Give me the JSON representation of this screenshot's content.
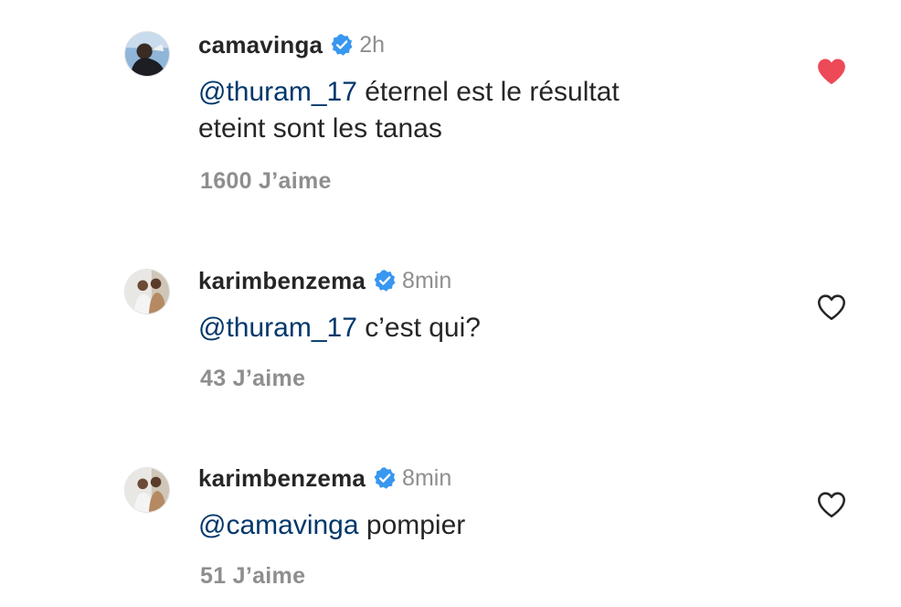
{
  "comments": [
    {
      "username": "camavinga",
      "verified_icon": "verified-badge-icon",
      "time": "2h",
      "mention": "@thuram_17",
      "text_line1": " éternel est le résultat",
      "text_line2": "eteint sont les tanas",
      "likes": "1600 J’aime",
      "liked": true,
      "like_icon": "heart-filled-icon"
    },
    {
      "username": "karimbenzema",
      "verified_icon": "verified-badge-icon",
      "time": "8min",
      "mention": "@thuram_17",
      "text": " c’est qui?",
      "likes": "43 J’aime",
      "liked": false,
      "like_icon": "heart-outline-icon"
    },
    {
      "username": "karimbenzema",
      "verified_icon": "verified-badge-icon",
      "time": "8min",
      "mention": "@camavinga",
      "text": " pompier",
      "likes": "51 J’aime",
      "liked": false,
      "like_icon": "heart-outline-icon"
    }
  ],
  "colors": {
    "text": "#262626",
    "secondary": "#8e8e8e",
    "mention": "#00376b",
    "verified": "#3897f0",
    "liked_heart": "#ed4956"
  }
}
